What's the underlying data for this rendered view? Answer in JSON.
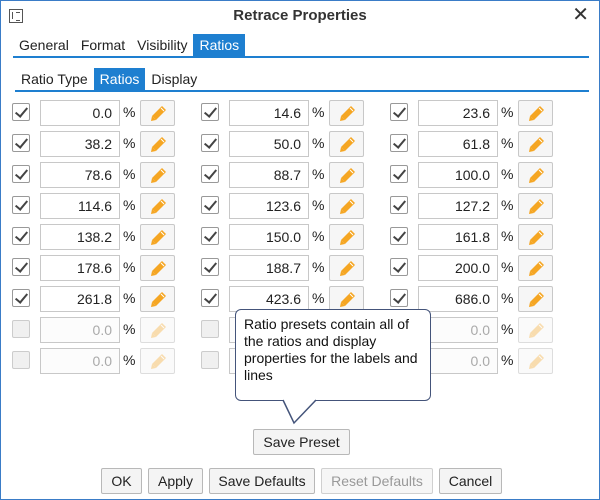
{
  "window": {
    "title": "Retrace Properties"
  },
  "main_tabs": [
    "General",
    "Format",
    "Visibility",
    "Ratios"
  ],
  "sub_tabs": [
    "Ratio Type",
    "Ratios",
    "Display"
  ],
  "percent_sign": "%",
  "rows": [
    [
      {
        "checked": true,
        "value": "0.0"
      },
      {
        "checked": true,
        "value": "14.6"
      },
      {
        "checked": true,
        "value": "23.6"
      }
    ],
    [
      {
        "checked": true,
        "value": "38.2"
      },
      {
        "checked": true,
        "value": "50.0"
      },
      {
        "checked": true,
        "value": "61.8"
      }
    ],
    [
      {
        "checked": true,
        "value": "78.6"
      },
      {
        "checked": true,
        "value": "88.7"
      },
      {
        "checked": true,
        "value": "100.0"
      }
    ],
    [
      {
        "checked": true,
        "value": "114.6"
      },
      {
        "checked": true,
        "value": "123.6"
      },
      {
        "checked": true,
        "value": "127.2"
      }
    ],
    [
      {
        "checked": true,
        "value": "138.2"
      },
      {
        "checked": true,
        "value": "150.0"
      },
      {
        "checked": true,
        "value": "161.8"
      }
    ],
    [
      {
        "checked": true,
        "value": "178.6"
      },
      {
        "checked": true,
        "value": "188.7"
      },
      {
        "checked": true,
        "value": "200.0"
      }
    ],
    [
      {
        "checked": true,
        "value": "261.8"
      },
      {
        "checked": true,
        "value": "423.6"
      },
      {
        "checked": true,
        "value": "686.0"
      }
    ],
    [
      {
        "checked": false,
        "value": "0.0"
      },
      {
        "checked": false,
        "value": ""
      },
      {
        "checked": false,
        "value": "0.0"
      }
    ],
    [
      {
        "checked": false,
        "value": "0.0"
      },
      {
        "checked": false,
        "value": ""
      },
      {
        "checked": false,
        "value": "0.0"
      }
    ]
  ],
  "tooltip": {
    "text": "Ratio presets contain all of the ratios and display properties for the labels and lines"
  },
  "buttons": {
    "save_preset": "Save Preset",
    "ok": "OK",
    "apply": "Apply",
    "save_defaults": "Save Defaults",
    "reset_defaults": "Reset Defaults",
    "cancel": "Cancel"
  },
  "colors": {
    "accent": "#1e7fd0",
    "pencil": "#f5a623",
    "tooltip_border": "#44547a"
  }
}
